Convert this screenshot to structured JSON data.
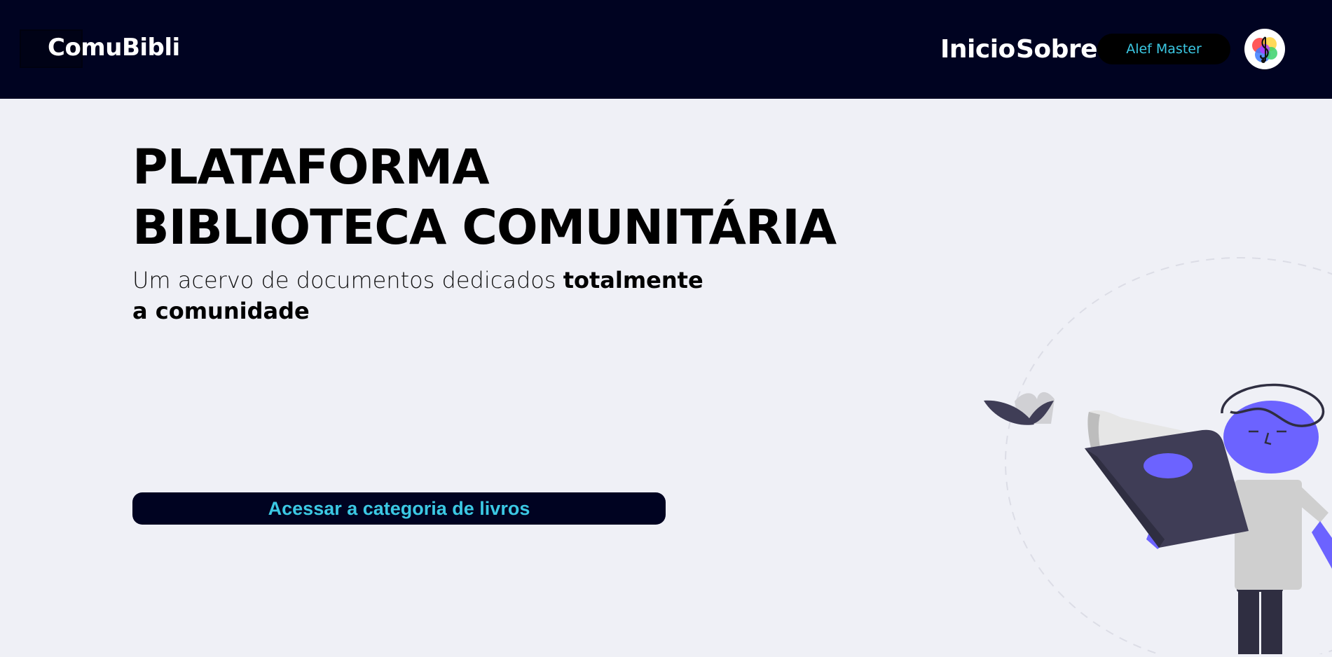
{
  "header": {
    "logo_text": "ComuBibli",
    "nav": {
      "inicio": "Inicio",
      "sobre": "Sobre"
    },
    "user_name": "Alef Master"
  },
  "hero": {
    "title_line1": "PLATAFORMA",
    "title_line2": "BIBLIOTECA COMUNITÁRIA",
    "subtitle_normal": "Um acervo de documentos dedicados ",
    "subtitle_bold": "totalmente a comunidade"
  },
  "cta": {
    "label": "Acessar a categoria de livros"
  },
  "icons": {
    "avatar": "music-note-avatar-icon",
    "illustration": "person-reading-book-illustration"
  },
  "colors": {
    "header_bg": "#000321",
    "page_bg": "#eff0f6",
    "accent": "#3bc8e3",
    "purple": "#6c63ff",
    "dark_book": "#3f3d56"
  }
}
